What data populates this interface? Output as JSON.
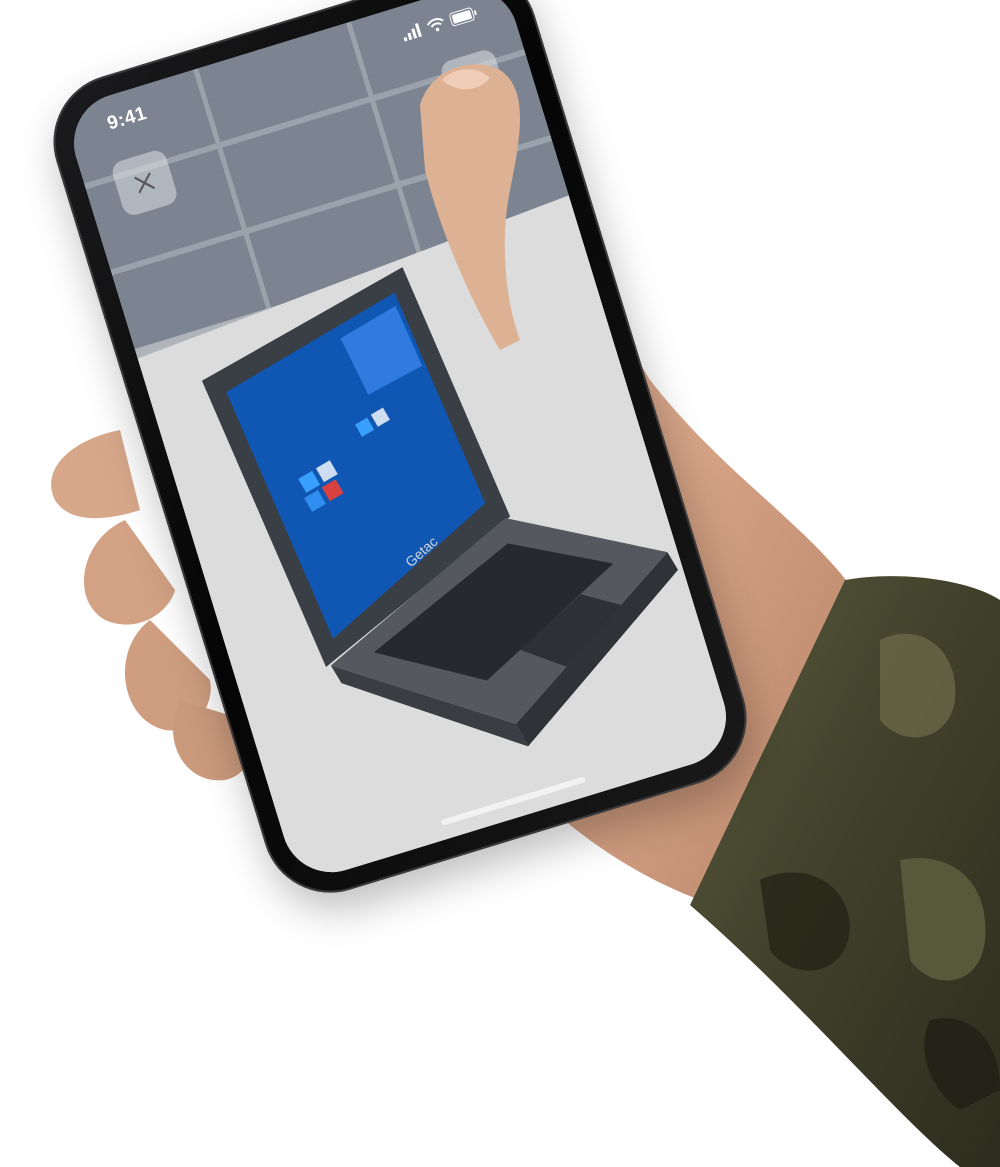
{
  "status_bar": {
    "time": "9:41"
  },
  "controls": {
    "close_icon": "close-icon",
    "share_icon": "share-icon"
  },
  "laptop": {
    "brand": "Getac"
  },
  "colors": {
    "phone_body": "#0b0b0c",
    "skin": "#d9a98d",
    "sleeve": "#4a4a32",
    "laptop_screen": "#0f57b3"
  }
}
